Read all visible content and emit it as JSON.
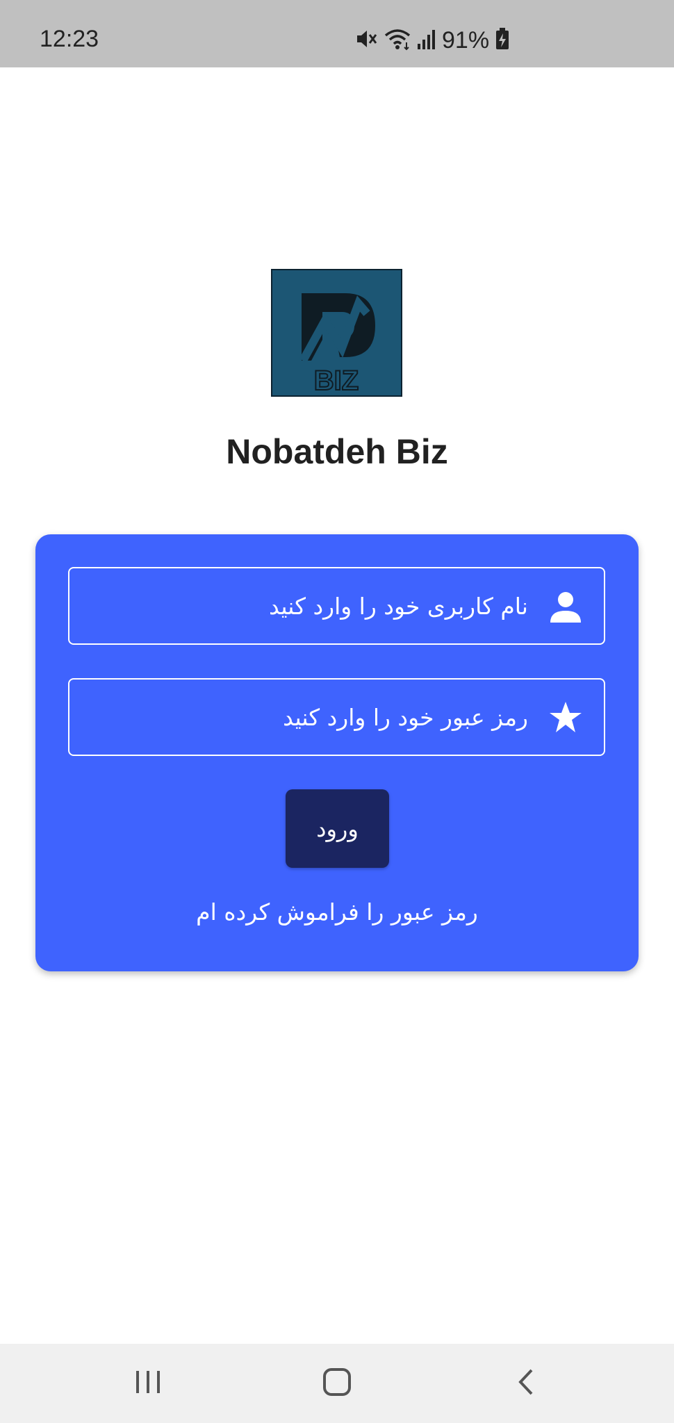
{
  "status_bar": {
    "time": "12:23",
    "battery_percent": "91%",
    "icons": [
      "mute-icon",
      "wifi-icon",
      "signal-icon",
      "battery-charging-icon"
    ]
  },
  "app": {
    "logo_text": "BIZ",
    "title": "Nobatdeh Biz"
  },
  "login_form": {
    "username_placeholder": "نام کاربری خود را وارد کنید",
    "username_icon": "person-icon",
    "password_placeholder": "رمز عبور خود را وارد کنید",
    "password_icon": "star-icon",
    "login_label": "ورود",
    "forgot_label": "رمز عبور را فراموش کرده ام"
  },
  "nav_bar": {
    "buttons": [
      "recent-apps-icon",
      "home-icon",
      "back-icon"
    ]
  },
  "colors": {
    "status_bar": "#c0c0c0",
    "card": "#3f63fe",
    "button": "#1b2561",
    "logo_bg": "#1c5674",
    "title": "#212121",
    "nav_bar": "#f0f0f0"
  }
}
